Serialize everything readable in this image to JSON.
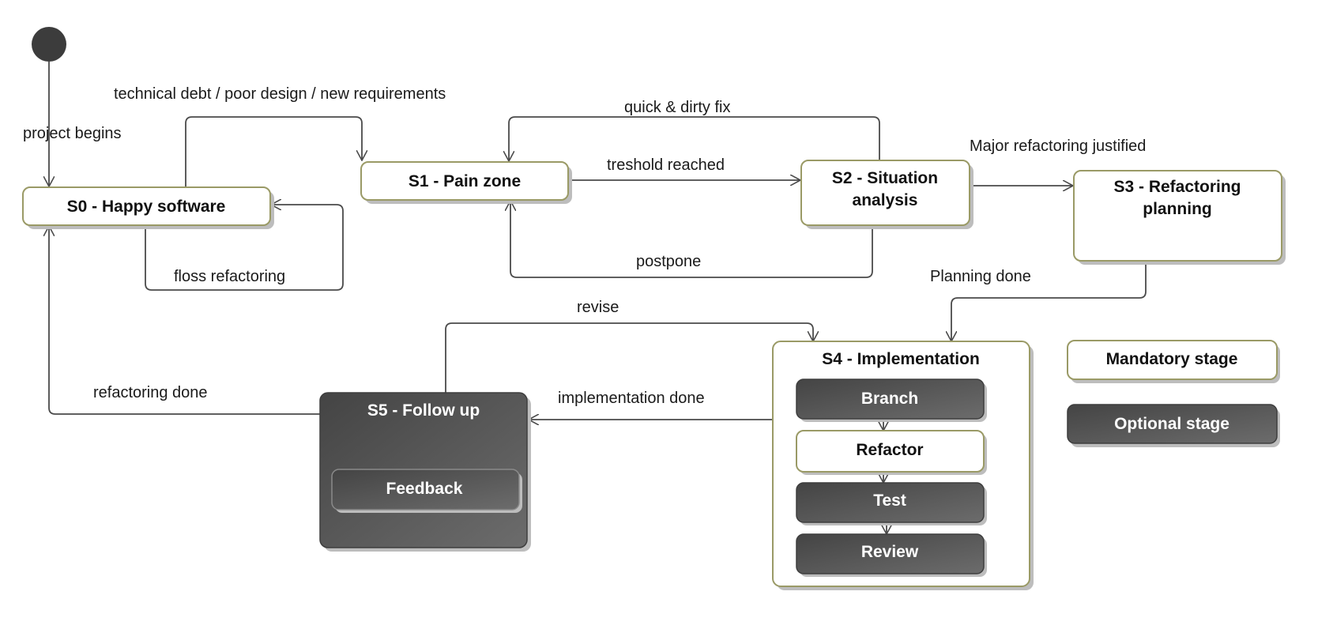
{
  "colors": {
    "mandatory_fill": "#ffffff",
    "mandatory_border": "#9a9a66",
    "optional_fill_dark": "#444444",
    "optional_fill_light": "#6c6c6c",
    "edge": "#4a4a4a"
  },
  "states": {
    "s0": "S0 - Happy software",
    "s1": "S1 - Pain zone",
    "s2": [
      "S2 - Situation",
      "analysis"
    ],
    "s3": [
      "S3 - Refactoring",
      "planning"
    ],
    "s4": {
      "title": "S4 - Implementation",
      "substates": [
        "Branch",
        "Refactor",
        "Test",
        "Review"
      ]
    },
    "s5": {
      "title": "S5 - Follow up",
      "substates": [
        "Feedback"
      ]
    }
  },
  "transitions": {
    "project_begins": "project begins",
    "technical_debt": "technical debt / poor design / new requirements",
    "floss_refactoring": "floss refactoring",
    "quick_dirty_fix": "quick & dirty fix",
    "threshold_reached": "treshold reached",
    "postpone": "postpone",
    "major_refactoring": "Major refactoring justified",
    "planning_done": "Planning done",
    "revise": "revise",
    "implementation_done": "implementation done",
    "refactoring_done": "refactoring done"
  },
  "legend": {
    "mandatory": "Mandatory stage",
    "optional": "Optional stage"
  }
}
